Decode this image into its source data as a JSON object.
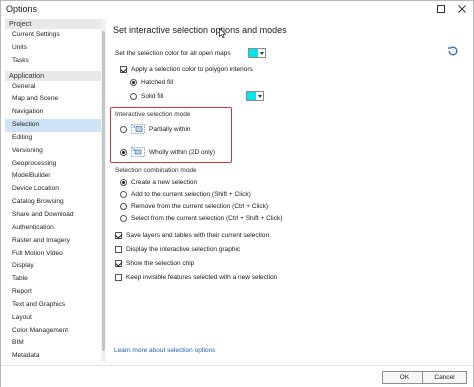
{
  "window": {
    "title": "Options"
  },
  "sidebar": {
    "sections": [
      {
        "header": "Project",
        "items": [
          "Current Settings",
          "Units",
          "Tasks"
        ]
      },
      {
        "header": "Application",
        "items": [
          "General",
          "Map and Scene",
          "Navigation",
          "Selection",
          "Editing",
          "Versioning",
          "Geoprocessing",
          "ModelBuilder",
          "Device Location",
          "Catalog Browsing",
          "Share and Download",
          "Authentication",
          "Raster and Imagery",
          "Full Motion Video",
          "Display",
          "Table",
          "Report",
          "Text and Graphics",
          "Layout",
          "Color Management",
          "BIM",
          "Metadata"
        ]
      }
    ],
    "selected": "Selection"
  },
  "main": {
    "title": "Set interactive selection options and modes",
    "selection_color_label": "Set the selection color for all open maps",
    "apply_color_label": "Apply a selection color to polygon interiors",
    "hatched_fill_label": "Hatched fill",
    "solid_fill_label": "Solid fill",
    "interactive_mode_label": "Interactive selection mode",
    "partially_within_label": "Partially within",
    "wholly_within_label": "Wholly within (2D only)",
    "combination_mode_label": "Selection combination mode",
    "combination_options": [
      "Create a new selection",
      "Add to the current selection (Shift + Click)",
      "Remove from the current selection (Ctrl + Click)",
      "Select from the current selection (Ctrl + Shift + Click)"
    ],
    "save_layers_label": "Save layers and tables with their current selection",
    "display_graphic_label": "Display the interactive selection graphic",
    "show_chip_label": "Show the selection chip",
    "keep_invisible_label": "Keep invisible features selected with a new selection",
    "learn_more_link": "Learn more about selection options"
  },
  "footer": {
    "ok_label": "OK",
    "cancel_label": "Cancel"
  },
  "colors": {
    "selection_color": "#00e5ee",
    "highlight_border": "#d1353a",
    "selected_item_bg": "#cfe3f6",
    "link": "#1b5fbf"
  }
}
